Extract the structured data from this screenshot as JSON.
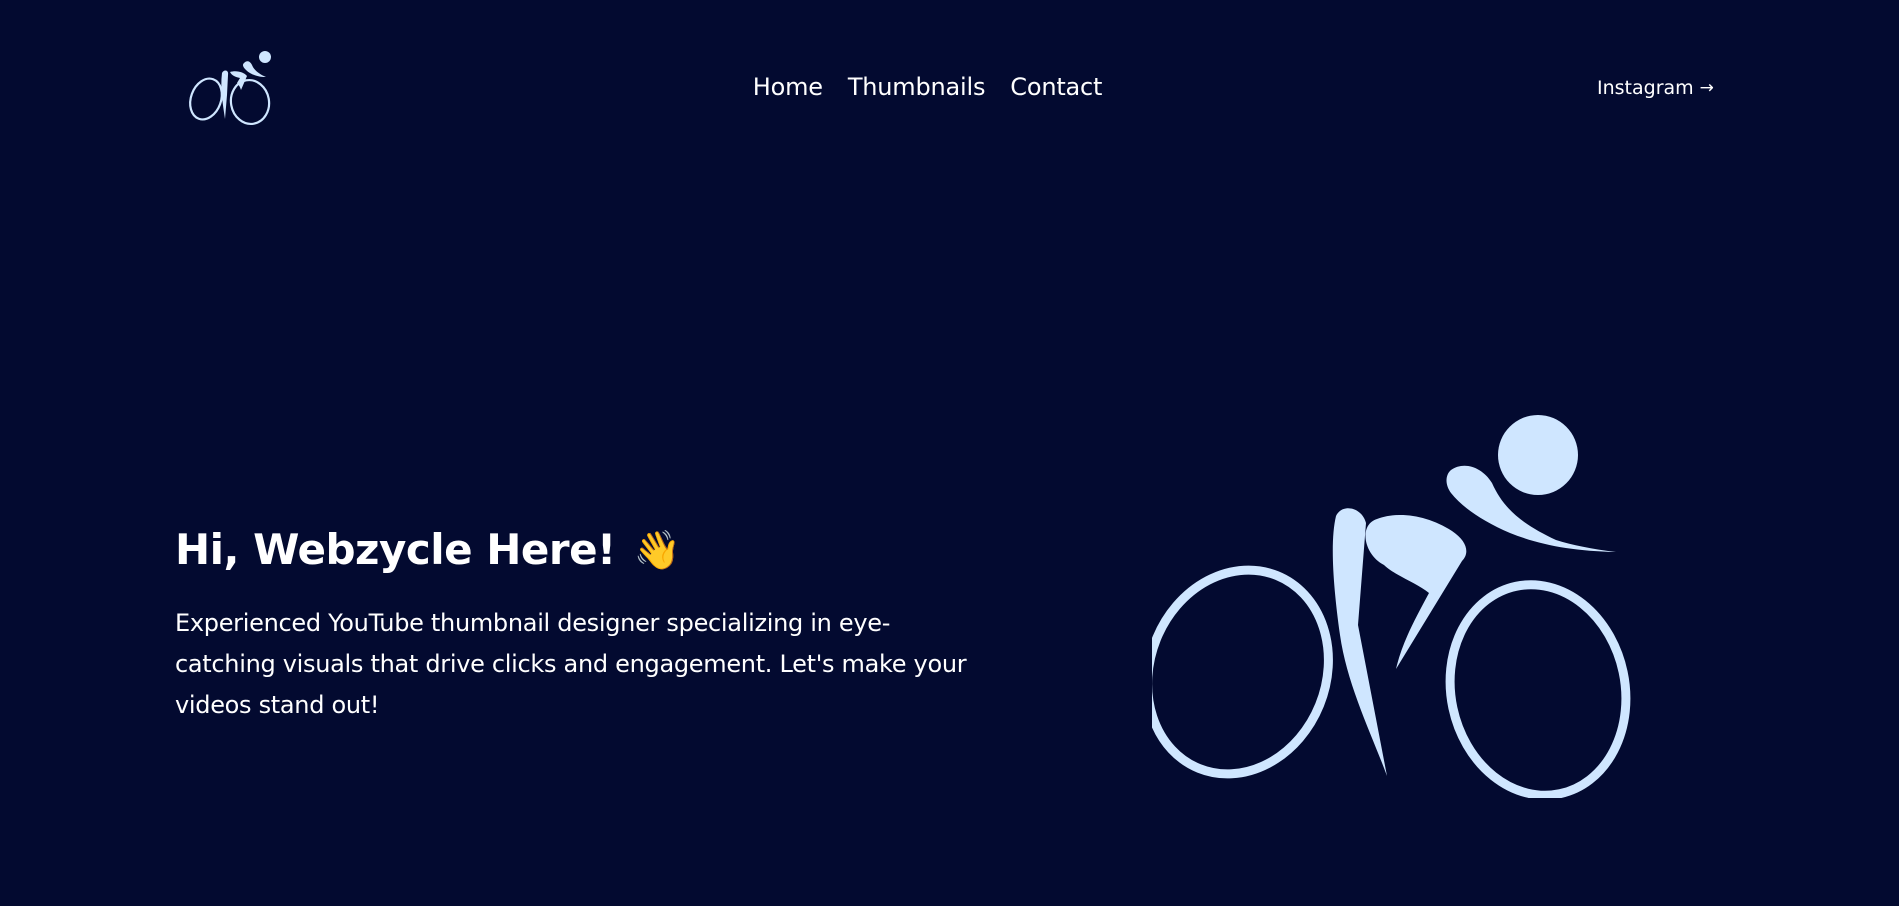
{
  "header": {
    "logo_icon": "cyclist-icon",
    "nav": [
      {
        "label": "Home"
      },
      {
        "label": "Thumbnails"
      },
      {
        "label": "Contact"
      }
    ],
    "instagram": {
      "label": "Instagram",
      "icon": "arrow-right-icon",
      "arrow": "→"
    }
  },
  "hero": {
    "title": "Hi, Webzycle Here!",
    "emoji": "👋",
    "description": "Experienced YouTube thumbnail designer specializing in eye-catching visuals that drive clicks and engagement. Let's make your videos stand out!",
    "illustration_icon": "cyclist-icon"
  },
  "colors": {
    "background": "#030a30",
    "text": "#ffffff",
    "logo": "#cfe6ff"
  }
}
